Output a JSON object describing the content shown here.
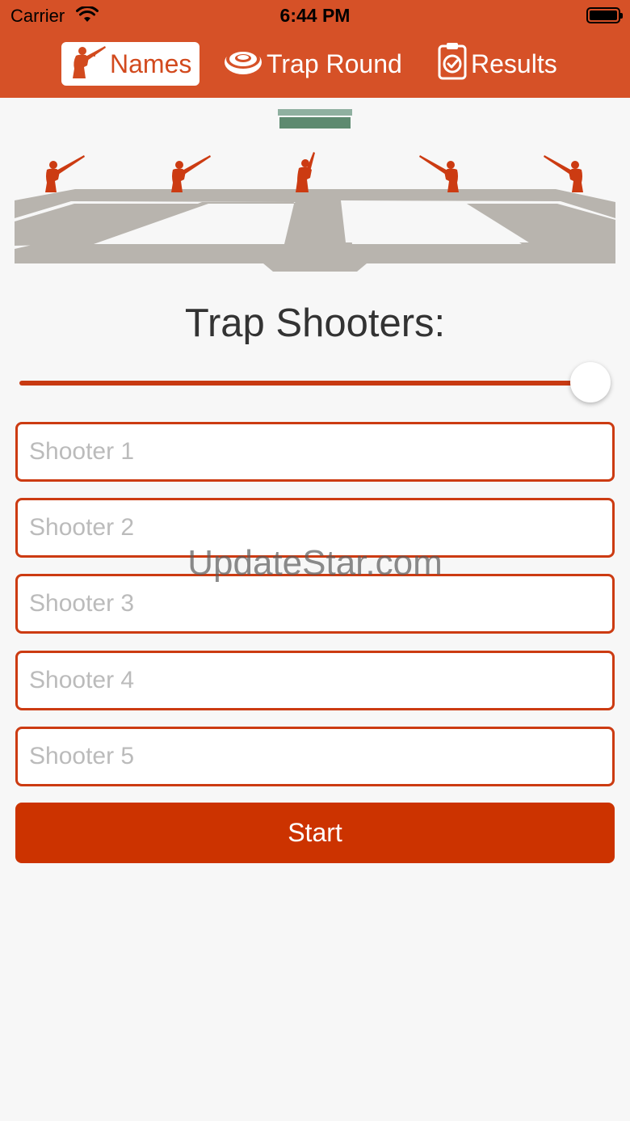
{
  "status_bar": {
    "carrier": "Carrier",
    "time": "6:44 PM",
    "icons": [
      "wifi-icon",
      "battery-icon"
    ]
  },
  "tabs": [
    {
      "label": "Names",
      "icon": "shooter-icon",
      "active": true
    },
    {
      "label": "Trap Round",
      "icon": "clay-target-icon",
      "active": false
    },
    {
      "label": "Results",
      "icon": "clipboard-check-icon",
      "active": false
    }
  ],
  "main": {
    "title": "Trap Shooters:",
    "shooter_count_slider": {
      "value": 5,
      "max": 5
    }
  },
  "shooters": [
    {
      "placeholder": "Shooter 1",
      "value": ""
    },
    {
      "placeholder": "Shooter 2",
      "value": ""
    },
    {
      "placeholder": "Shooter 3",
      "value": ""
    },
    {
      "placeholder": "Shooter 4",
      "value": ""
    },
    {
      "placeholder": "Shooter 5",
      "value": ""
    }
  ],
  "start_button": {
    "label": "Start"
  },
  "watermark": "UpdateStar.com",
  "colors": {
    "header": "#d65127",
    "accent": "#cc3300",
    "field": "#b8b4ae",
    "trap_house": "#5e8a70"
  }
}
